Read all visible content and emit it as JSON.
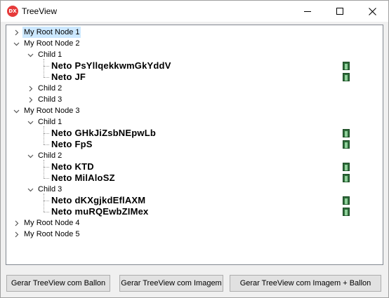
{
  "window": {
    "title": "TreeView",
    "app_icon": "DX"
  },
  "tree": {
    "roots": [
      {
        "label": "My Root Node 1",
        "selected": true
      },
      {
        "label": "My Root Node 2",
        "children": [
          {
            "label": "Child 1",
            "grandchildren": [
              "Neto PsYllqekkwmGkYddV",
              "Neto JF"
            ]
          },
          {
            "label": "Child 2"
          },
          {
            "label": "Child 3"
          }
        ]
      },
      {
        "label": "My Root Node 3",
        "children": [
          {
            "label": "Child 1",
            "grandchildren": [
              "Neto GHkJiZsbNEpwLb",
              "Neto FpS"
            ]
          },
          {
            "label": "Child 2",
            "grandchildren": [
              "Neto KTD",
              "Neto MilAloSZ"
            ]
          },
          {
            "label": "Child 3",
            "grandchildren": [
              "Neto dKXgjkdEflAXM",
              "Neto  muRQEwbZIMex"
            ]
          }
        ]
      },
      {
        "label": "My Root Node 4"
      },
      {
        "label": "My Root Node 5"
      }
    ]
  },
  "buttons": {
    "balloon": "Gerar TreeView com Ballon",
    "image": "Gerar TreeView com Imagem",
    "image_balloon": "Gerar TreeView com Imagem + Ballon"
  },
  "icons": {
    "app": "app-icon",
    "minimize": "minimize-icon",
    "maximize": "maximize-icon",
    "close": "close-icon",
    "expand": "chevron-right-icon",
    "collapse": "chevron-down-icon",
    "node_image": "film-icon"
  }
}
